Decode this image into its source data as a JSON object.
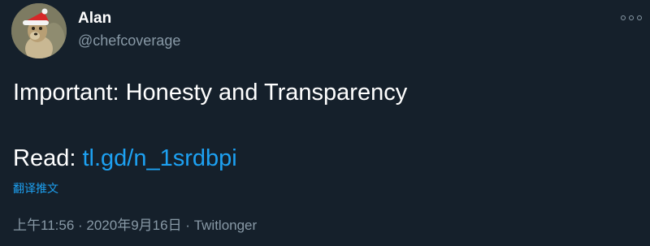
{
  "user": {
    "display_name": "Alan",
    "handle": "@chefcoverage",
    "avatar_icon": "meerkat-santa-hat-avatar"
  },
  "tweet": {
    "line1": "Important: Honesty and Transparency",
    "read_prefix": "Read: ",
    "link_text": "tl.gd/n_1srdbpi",
    "translate_label": "翻译推文"
  },
  "meta": {
    "time": "上午11:56",
    "separator1": " · ",
    "date": "2020年9月16日",
    "separator2": " · ",
    "source": "Twitlonger"
  },
  "icons": {
    "more": "more-options-icon"
  },
  "colors": {
    "background": "#15202b",
    "text": "#ffffff",
    "secondary": "#8899a6",
    "link": "#1da1f2"
  }
}
